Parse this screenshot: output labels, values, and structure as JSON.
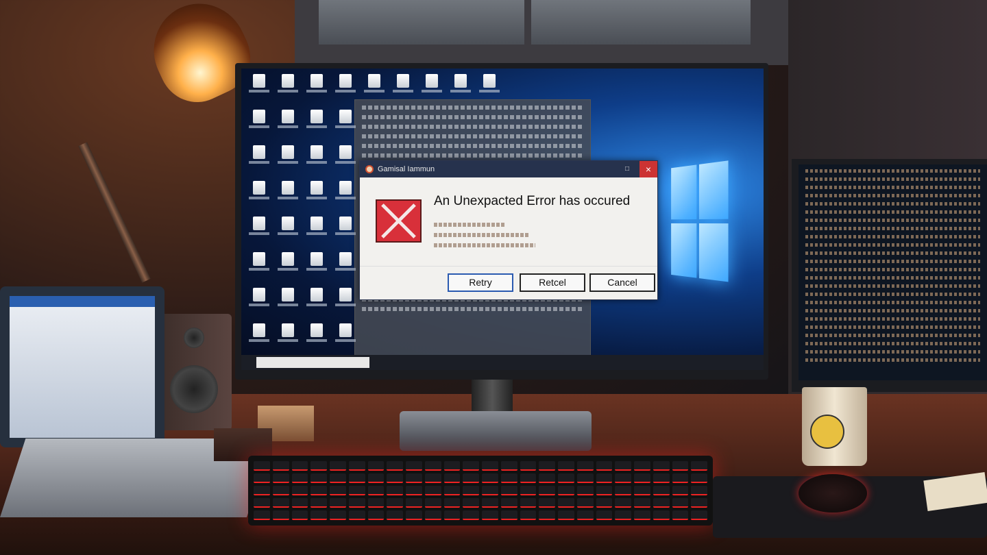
{
  "dialog": {
    "title": "Gamisal Iammun",
    "headline": "An Unexpacted Error has occured",
    "buttons": {
      "retry": "Retry",
      "retcel": "Retcel",
      "cancel": "Cancel"
    },
    "icon": "error-x-icon",
    "close_icon": "×",
    "restore_icon": "□"
  },
  "colors": {
    "dialog_titlebar": "#26324d",
    "error_icon": "#d8303a",
    "close_button": "#cc3333",
    "keyboard_glow": "#ee2222"
  }
}
